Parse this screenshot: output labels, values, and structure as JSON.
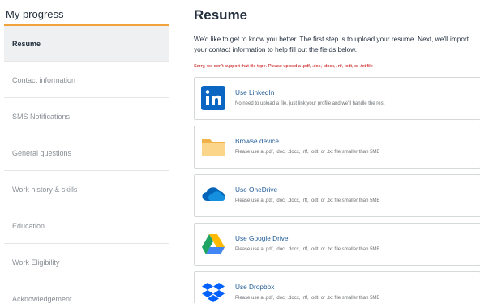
{
  "sidebar": {
    "title": "My progress",
    "steps": [
      {
        "label": "Resume"
      },
      {
        "label": "Contact information"
      },
      {
        "label": "SMS Notifications"
      },
      {
        "label": "General questions"
      },
      {
        "label": "Work history & skills"
      },
      {
        "label": "Education"
      },
      {
        "label": "Work Eligibility"
      },
      {
        "label": "Acknowledgement"
      }
    ]
  },
  "main": {
    "title": "Resume",
    "intro": "We'd like to get to know you better. The first step is to upload your resume. Next, we'll import your contact information to help fill out the fields below.",
    "error": "Sorry, we don't support that file type. Please upload a .pdf, .doc, .docx, .rtf, .odt, or .txt file",
    "options": [
      {
        "title": "Use LinkedIn",
        "description": "No need to upload a file, just link your profile and we'll handle the rest",
        "icon": "linkedin-icon"
      },
      {
        "title": "Browse device",
        "description": "Please use a .pdf, .doc, .docx, .rtf, .odt, or .txt file smaller than 5MB",
        "icon": "folder-icon"
      },
      {
        "title": "Use OneDrive",
        "description": "Please use a .pdf, .doc, .docx, .rtf, .odt, or .txt file smaller than 5MB",
        "icon": "onedrive-icon"
      },
      {
        "title": "Use Google Drive",
        "description": "Please use a .pdf, .doc, .docx, .rtf, .odt, or .txt file smaller than 5MB",
        "icon": "google-drive-icon"
      },
      {
        "title": "Use Dropbox",
        "description": "Please use a .pdf, .doc, .docx, .rtf, .odt, or .txt file smaller than 5MB",
        "icon": "dropbox-icon"
      }
    ]
  },
  "colors": {
    "accent": "#f0a33a",
    "link": "#1f5a96",
    "error": "#c40000",
    "linkedin": "#0a66c2",
    "onedrive": "#0364b8"
  }
}
